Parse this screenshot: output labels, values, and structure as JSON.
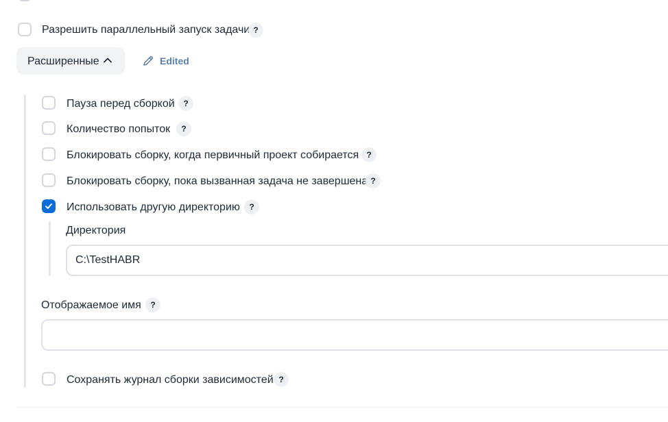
{
  "options": {
    "parallel": {
      "label": "Разрешить параллельный запуск задачи",
      "help": "?",
      "checked": false
    }
  },
  "advanced": {
    "button_label": "Расширенные",
    "edited_label": "Edited",
    "items": [
      {
        "label": "Пауза перед сборкой",
        "help": "?",
        "checked": false
      },
      {
        "label": "Количество попыток",
        "help": "?",
        "checked": false
      },
      {
        "label": "Блокировать сборку, когда первичный проект собирается",
        "help": "?",
        "checked": false
      },
      {
        "label": "Блокировать сборку, пока вызванная задача не завершена",
        "help": "?",
        "checked": false
      },
      {
        "label": "Использовать другую директорию",
        "help": "?",
        "checked": true
      }
    ],
    "directory": {
      "label": "Директория",
      "value": "C:\\TestHABR"
    },
    "display_name": {
      "label": "Отображаемое имя",
      "help": "?",
      "value": ""
    },
    "save_log": {
      "label": "Сохранять журнал сборки зависимостей",
      "help": "?",
      "checked": false
    }
  },
  "colors": {
    "accent": "#0b6cdb",
    "edited": "#5a7fa8"
  }
}
